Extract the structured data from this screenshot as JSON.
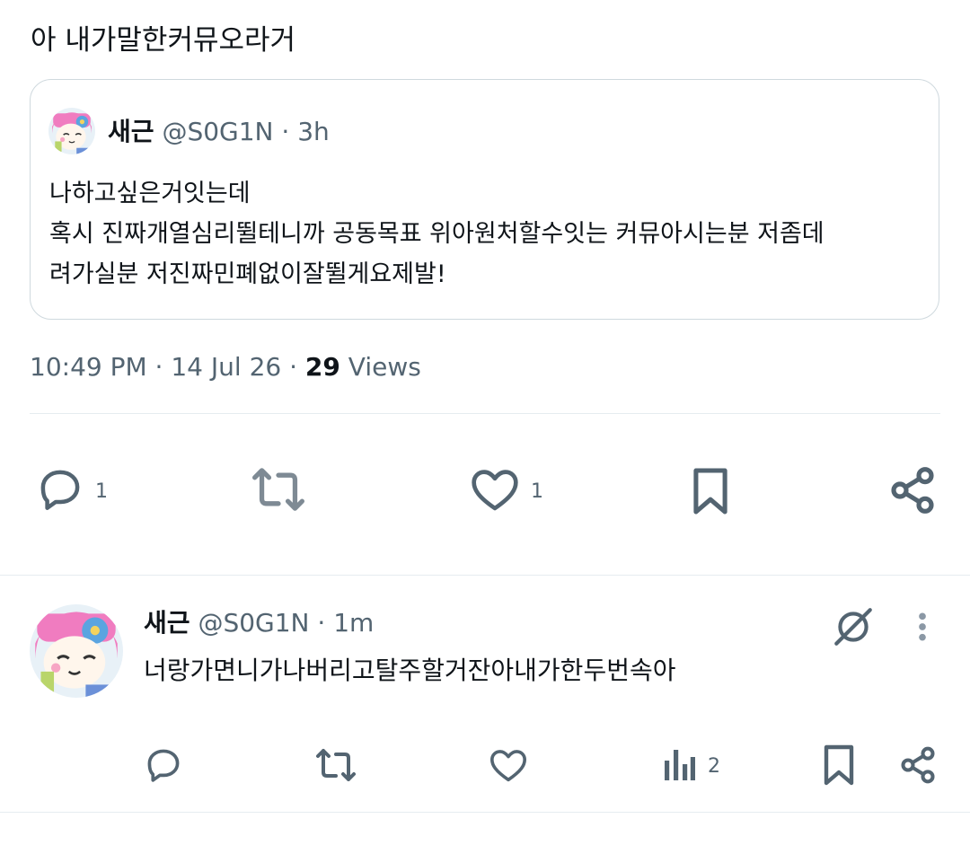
{
  "post": {
    "text": "아 내가말한커뮤오라거",
    "meta": {
      "time": "10:49 PM",
      "dot1": "·",
      "date": "14 Jul 26",
      "dot2": "·",
      "views_count": "29",
      "views_label": "Views"
    },
    "actions": {
      "reply_count": "1",
      "like_count": "1"
    }
  },
  "quote": {
    "display_name": "새근",
    "handle": "@S0G1N",
    "dot": "·",
    "time": "3h",
    "lines": [
      "나하고싶은거잇는데",
      "혹시 진짜개열심리뛸테니까 공동목표 위아원처할수잇는 커뮤아시는분 저좀데",
      "려가실분 저진짜민폐없이잘뛸게요제발!"
    ]
  },
  "reply": {
    "display_name": "새근",
    "handle": "@S0G1N",
    "dot": "·",
    "time": "1m",
    "text": "너랑가면니가나버리고탈주할거잔아내가한두번속아",
    "actions": {
      "views_count": "2"
    }
  },
  "colors": {
    "text": "#0f1419",
    "muted": "#536471",
    "border": "#cfd9de",
    "divider": "#e6ecf0"
  },
  "icons": [
    "reply-icon",
    "repost-icon",
    "like-icon",
    "bookmark-icon",
    "share-icon",
    "grok-icon",
    "more-icon",
    "views-icon"
  ]
}
